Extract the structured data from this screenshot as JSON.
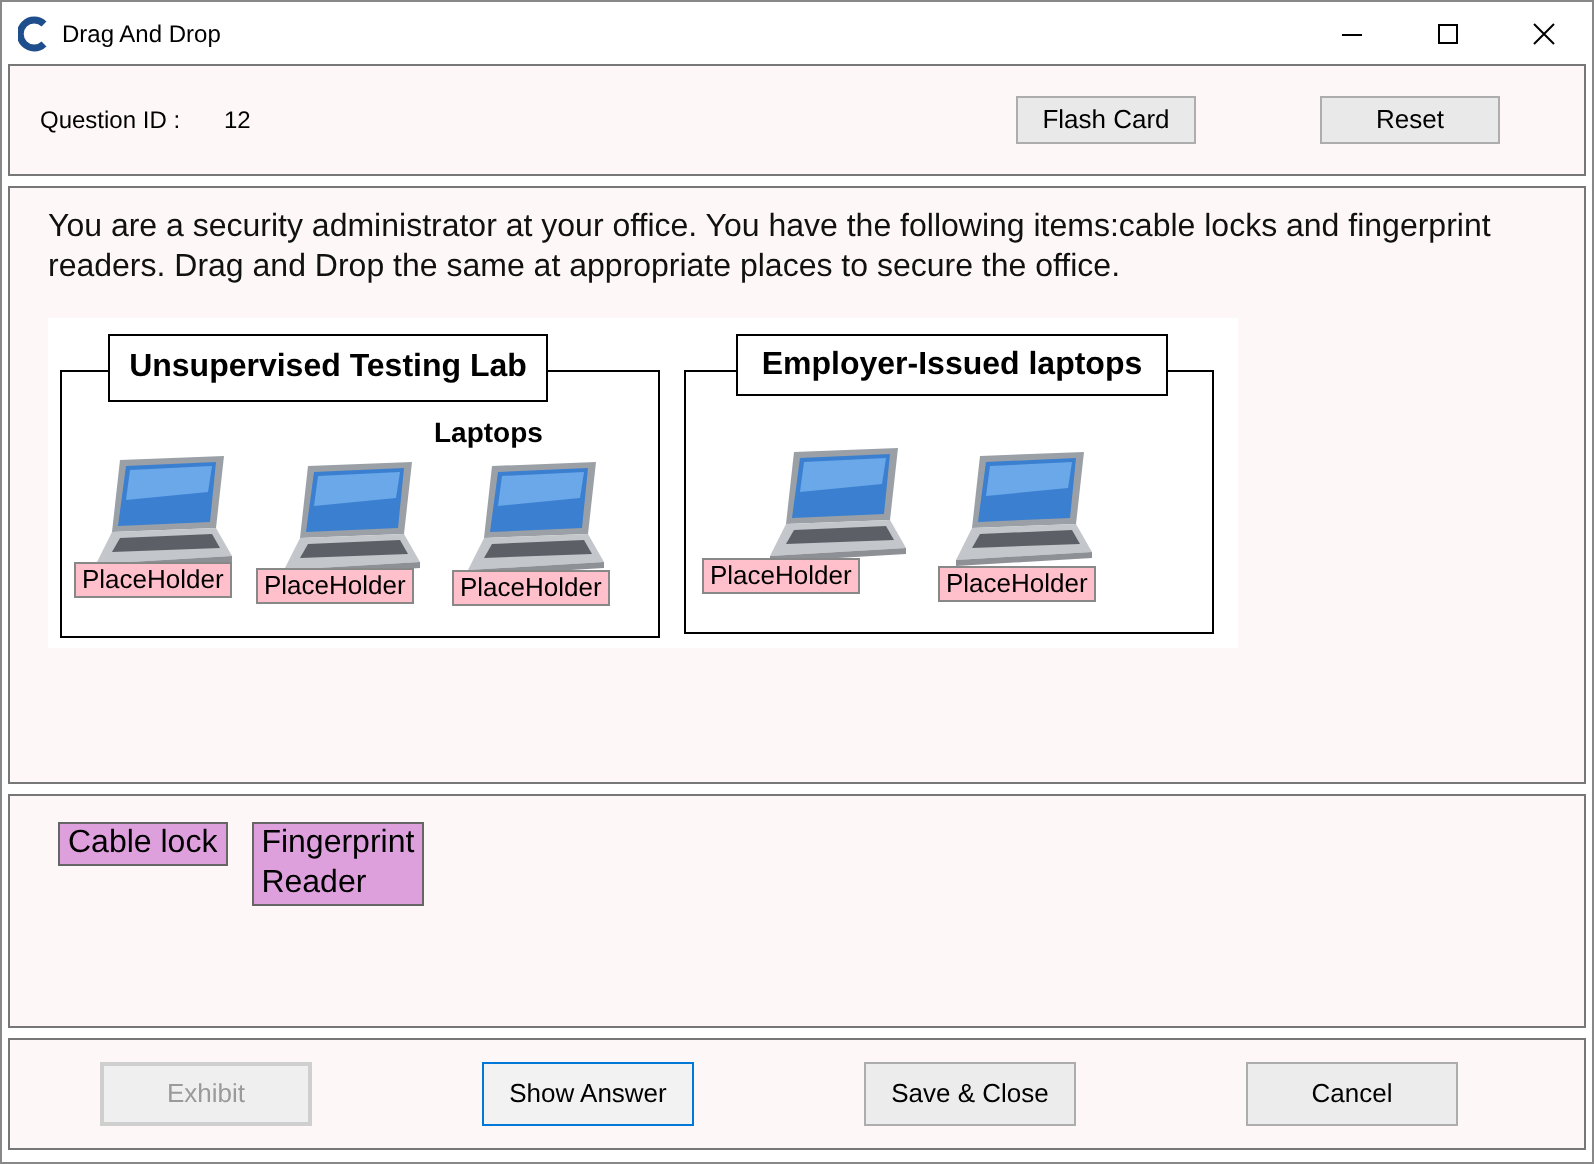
{
  "window": {
    "title": "Drag And Drop"
  },
  "header": {
    "question_id_label": "Question ID :",
    "question_id": "12",
    "buttons": [
      {
        "label": "Flash Card",
        "disabled": false
      },
      {
        "label": "Reset",
        "disabled": false
      }
    ]
  },
  "question": {
    "text": "You are a security administrator at your office. You have the following items:cable locks and fingerprint readers. Drag and Drop the same at appropriate places to secure the office.",
    "groups": [
      {
        "title": "Unsupervised Testing Lab",
        "subtitle": "Laptops",
        "targets": [
          "PlaceHolder",
          "PlaceHolder",
          "PlaceHolder"
        ]
      },
      {
        "title": "Employer-Issued laptops",
        "targets": [
          "PlaceHolder",
          "PlaceHolder"
        ]
      }
    ]
  },
  "answers": [
    "Cable lock",
    "Fingerprint Reader"
  ],
  "footer": {
    "buttons": [
      {
        "label": "Exhibit",
        "disabled": true,
        "selected": false
      },
      {
        "label": "Show Answer",
        "disabled": false,
        "selected": true
      },
      {
        "label": "Save & Close",
        "disabled": false,
        "selected": false
      },
      {
        "label": "Cancel",
        "disabled": false,
        "selected": false
      }
    ]
  }
}
